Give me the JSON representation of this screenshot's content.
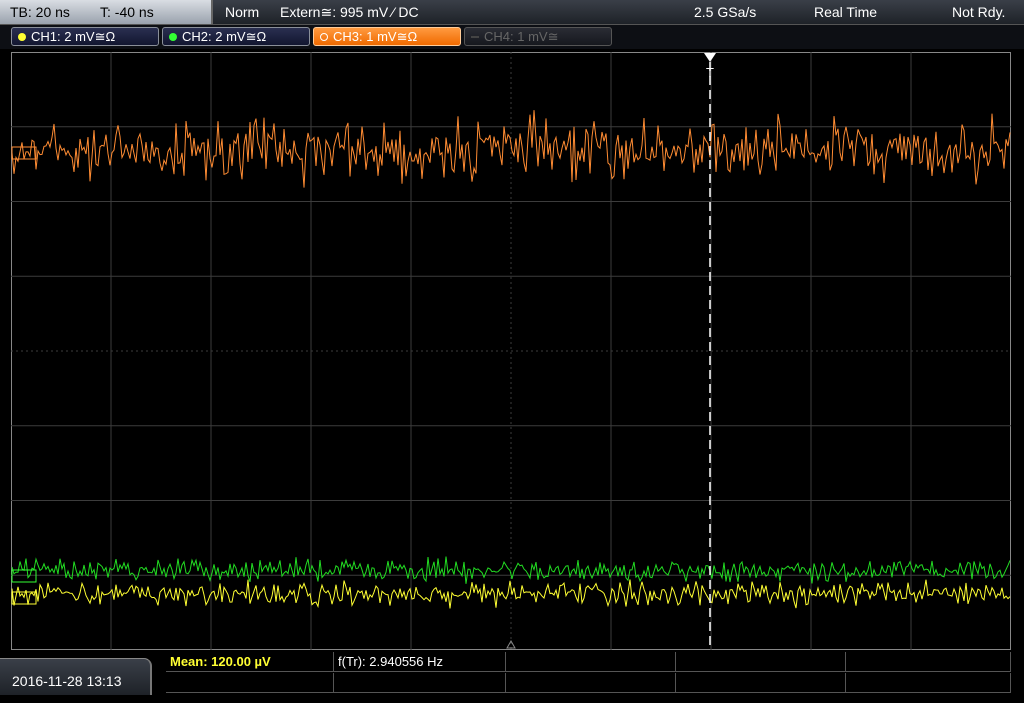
{
  "topbar": {
    "timebase": "TB: 20 ns",
    "trigger_offset": "T: -40 ns",
    "trigger_mode": "Norm",
    "trigger_source": "Extern≅: 995 mV ⁄ DC",
    "sample_rate": "2.5 GSa/s",
    "acq_mode": "Real Time",
    "run_state": "Not Rdy."
  },
  "channels": [
    {
      "label": "CH1: 2 mV≅Ω",
      "color": "#ffff33"
    },
    {
      "label": "CH2: 2 mV≅Ω",
      "color": "#33ff33"
    },
    {
      "label": "CH3: 1 mV≅Ω",
      "color": "#ff8c33"
    },
    {
      "label": "CH4: 1 mV≅",
      "color": "#555555"
    }
  ],
  "trigger_marker": "T",
  "bottombar": {
    "datetime": "2016-11-28 13:13",
    "mean": "Mean: 120.00 µV",
    "freq": "f(Tr): 2.940556 Hz"
  },
  "colors": {
    "ch1": "#ffff33",
    "ch2": "#22dd22",
    "ch3": "#ff8c33",
    "grid": "#3c3c3c",
    "mean_text": "#ffff33"
  }
}
